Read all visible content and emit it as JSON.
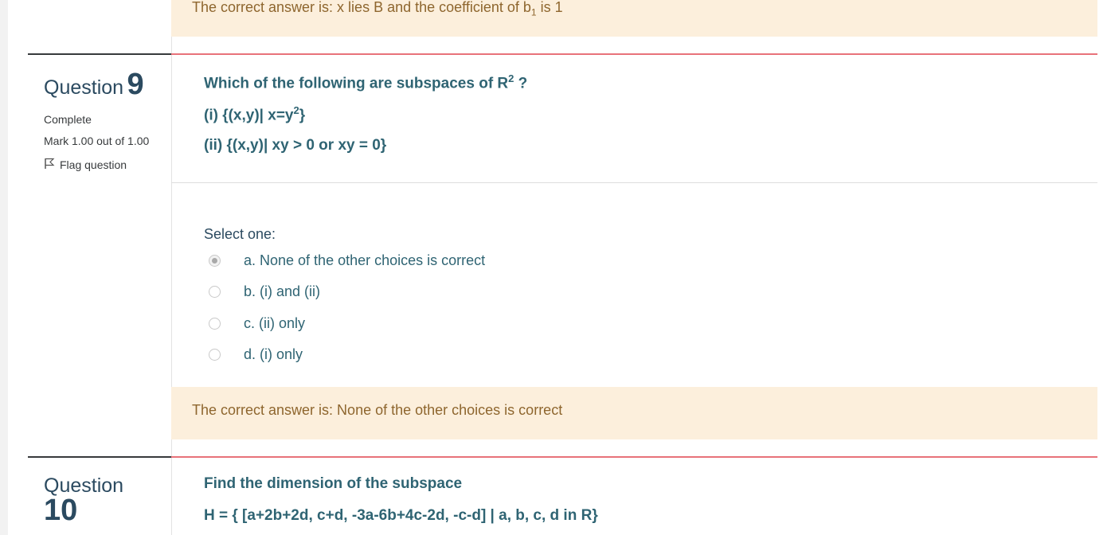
{
  "prev_feedback": {
    "text_before_sub": "The correct answer is: x lies B and the coefficient of b",
    "sub": "1",
    "text_after_sub": " is 1"
  },
  "question9": {
    "label": "Question",
    "number": "9",
    "state": "Complete",
    "grade": "Mark 1.00 out of 1.00",
    "flag_label": "Flag question",
    "text_line1_before": "Which of the following are subspaces of R",
    "text_line1_sup": "2",
    "text_line1_after": " ?",
    "text_line2_before": "(i) {(x,y)| x=y",
    "text_line2_sup": "2",
    "text_line2_after": "}",
    "text_line3": "(ii) {(x,y)| xy > 0 or xy = 0}",
    "prompt": "Select one:",
    "options": [
      {
        "label": "a. None of the other choices is correct",
        "checked": true
      },
      {
        "label": "b. (i) and (ii)",
        "checked": false
      },
      {
        "label": "c. (ii) only",
        "checked": false
      },
      {
        "label": "d. (i) only",
        "checked": false
      }
    ],
    "feedback": "The correct answer is: None of the other choices is correct"
  },
  "question10": {
    "label": "Question",
    "number": "10",
    "text_line1": "Find the dimension of the subspace",
    "text_line2": "H = { [a+2b+2d, c+d, -3a-6b+4c-2d, -c-d] | a, b, c, d in R}"
  },
  "colors": {
    "feedback_bg": "#fcefdc",
    "feedback_text": "#8e662e",
    "accent_line": "#e8727a",
    "question_text": "#2f6473"
  }
}
